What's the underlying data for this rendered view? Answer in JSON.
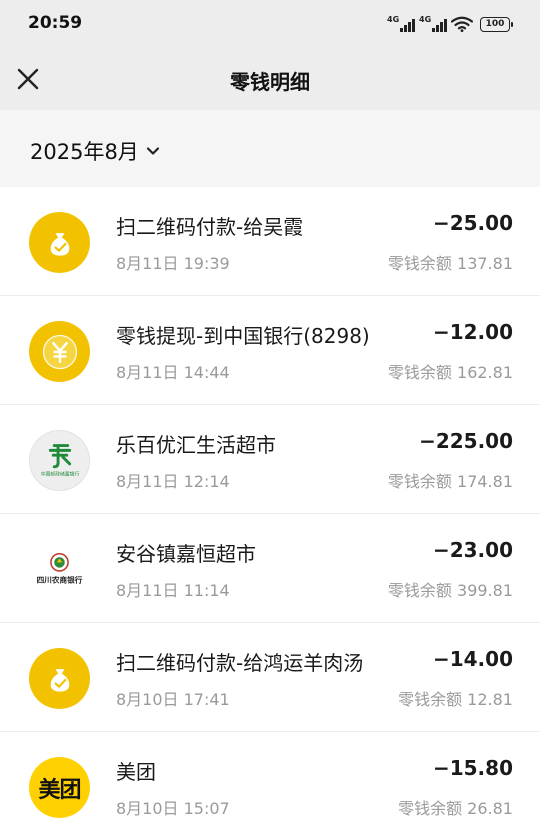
{
  "status": {
    "time": "20:59",
    "net1": "4G",
    "net2": "4G",
    "battery": "100"
  },
  "nav": {
    "title": "零钱明细"
  },
  "filter": {
    "month": "2025年8月"
  },
  "transactions": [
    {
      "icon": "money-bag-icon",
      "style": "yellow",
      "title": "扫二维码付款-给吴霞",
      "time": "8月11日 19:39",
      "amount": "−25.00",
      "balance": "零钱余额 137.81"
    },
    {
      "icon": "yuan-coin-icon",
      "style": "yellow",
      "title": "零钱提现-到中国银行(8298)",
      "time": "8月11日 14:44",
      "amount": "−12.00",
      "balance": "零钱余额 162.81"
    },
    {
      "icon": "china-post-bank-logo-icon",
      "style": "gray",
      "title": "乐百优汇生活超市",
      "time": "8月11日 12:14",
      "amount": "−225.00",
      "balance": "零钱余额 174.81",
      "logo_text": "中国邮政储蓄银行"
    },
    {
      "icon": "sichuan-rural-bank-logo-icon",
      "style": "plain",
      "title": "安谷镇嘉恒超市",
      "time": "8月11日 11:14",
      "amount": "−23.00",
      "balance": "零钱余额 399.81",
      "logo_text": "四川农商银行"
    },
    {
      "icon": "money-bag-icon",
      "style": "yellow",
      "title": "扫二维码付款-给鸿运羊肉汤",
      "time": "8月10日 17:41",
      "amount": "−14.00",
      "balance": "零钱余额 12.81"
    },
    {
      "icon": "meituan-logo-icon",
      "style": "meituan",
      "title": "美团",
      "time": "8月10日 15:07",
      "amount": "−15.80",
      "balance": "零钱余额 26.81",
      "logo_text": "美团"
    }
  ],
  "colors": {
    "header_bg": "#ededed",
    "filter_bg": "#f5f5f5",
    "wechat_yellow": "#f2c200",
    "meituan_yellow": "#ffd100",
    "secondary_text": "#9a9a9a"
  }
}
